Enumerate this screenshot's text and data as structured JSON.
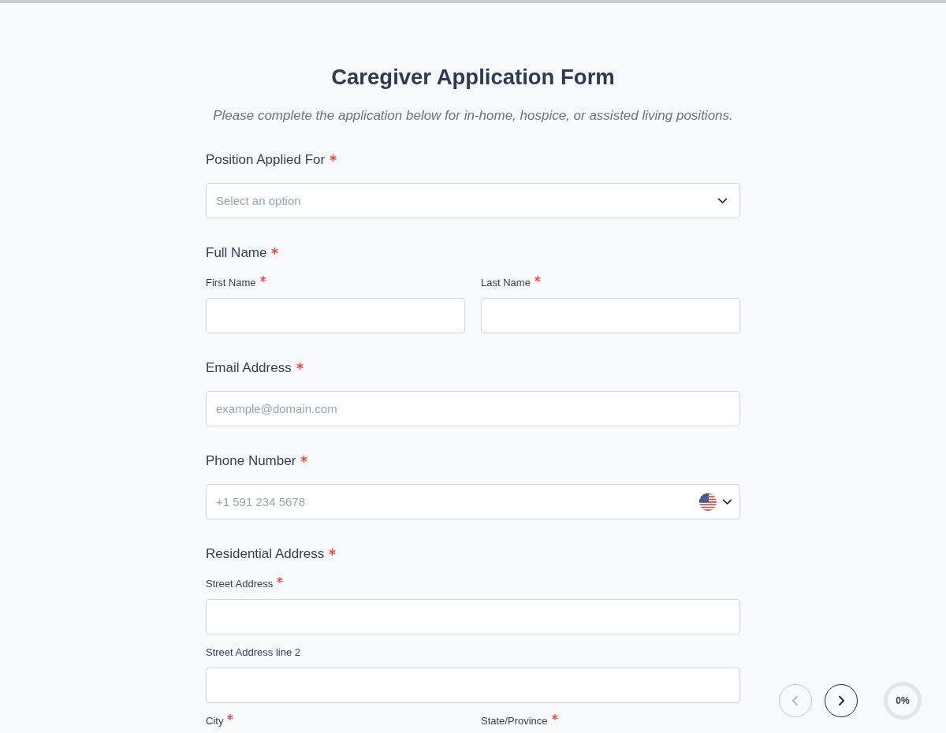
{
  "header": {
    "title": "Caregiver Application Form",
    "subtitle": "Please complete the application below for in-home, hospice, or assisted living positions."
  },
  "fields": [
    {
      "kind": "select",
      "label": "Position Applied For",
      "required": true,
      "placeholder": "Select an option"
    },
    {
      "kind": "group",
      "label": "Full Name",
      "required": true,
      "rows": [
        [
          {
            "kind": "text",
            "label": "First Name",
            "required": true
          },
          {
            "kind": "text",
            "label": "Last Name",
            "required": true
          }
        ]
      ]
    },
    {
      "kind": "email",
      "label": "Email Address",
      "required": true,
      "placeholder": "example@domain.com"
    },
    {
      "kind": "phone",
      "label": "Phone Number",
      "required": true,
      "placeholder": "+1 591 234 5678"
    },
    {
      "kind": "group",
      "label": "Residential Address",
      "required": true,
      "rows": [
        [
          {
            "kind": "text",
            "label": "Street Address",
            "required": true
          }
        ],
        [
          {
            "kind": "text",
            "label": "Street Address line 2",
            "required": false
          }
        ],
        [
          {
            "kind": "label_only",
            "label": "City",
            "required": true
          },
          {
            "kind": "label_only",
            "label": "State/Province",
            "required": true
          }
        ]
      ]
    }
  ],
  "navigation": {
    "previous": {
      "disabled": true
    },
    "next": {
      "disabled": false
    }
  },
  "progress": {
    "level": 0,
    "text": "0%"
  }
}
